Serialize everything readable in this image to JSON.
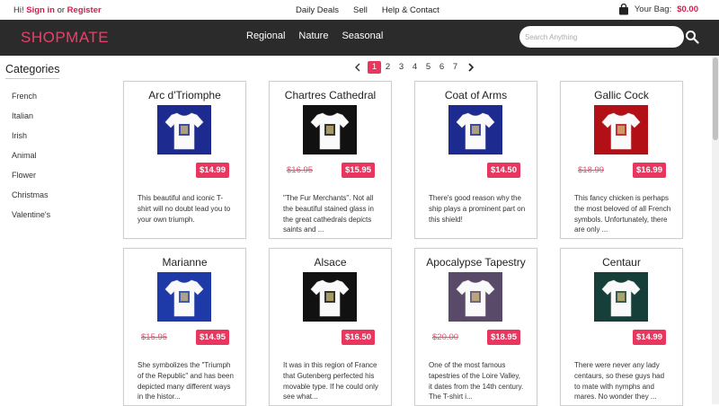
{
  "topbar": {
    "greet": "Hi!",
    "sign_in": "Sign in",
    "or": "or",
    "register": "Register",
    "links": [
      "Daily Deals",
      "Sell",
      "Help & Contact"
    ],
    "bag_label": "Your Bag:",
    "bag_amount": "$0.00"
  },
  "nav": {
    "logo": "SHOPMATE",
    "menu": [
      "Regional",
      "Nature",
      "Seasonal"
    ],
    "search_placeholder": "Search Anything"
  },
  "categories": {
    "title": "Categories",
    "items": [
      "French",
      "Italian",
      "Irish",
      "Animal",
      "Flower",
      "Christmas",
      "Valentine's"
    ]
  },
  "pagination": {
    "pages": [
      "1",
      "2",
      "3",
      "4",
      "5",
      "6",
      "7"
    ],
    "active": "1"
  },
  "products": [
    {
      "name": "Arc d'Triomphe",
      "old_price": "",
      "price": "$14.99",
      "color": "#1d2a8f",
      "desc": "This beautiful and iconic T-shirt will no doubt lead you to your own triumph."
    },
    {
      "name": "Chartres Cathedral",
      "old_price": "$16.95",
      "price": "$15.95",
      "color": "#111111",
      "desc": "\"The Fur Merchants\". Not all the beautiful stained glass in the great cathedrals depicts saints and ..."
    },
    {
      "name": "Coat of Arms",
      "old_price": "",
      "price": "$14.50",
      "color": "#1d2a8f",
      "desc": "There's good reason why the ship plays a prominent part on this shield!"
    },
    {
      "name": "Gallic Cock",
      "old_price": "$18.99",
      "price": "$16.99",
      "color": "#b30f16",
      "desc": "This fancy chicken is perhaps the most beloved of all French symbols. Unfortunately, there are only ..."
    },
    {
      "name": "Marianne",
      "old_price": "$15.95",
      "price": "$14.95",
      "color": "#1d3aa8",
      "desc": "She symbolizes the \"Triumph of the Republic\" and has been depicted many different ways in the histor..."
    },
    {
      "name": "Alsace",
      "old_price": "",
      "price": "$16.50",
      "color": "#111111",
      "desc": "It was in this region of France that Gutenberg perfected his movable type. If he could only see what..."
    },
    {
      "name": "Apocalypse Tapestry",
      "old_price": "$20.00",
      "price": "$18.95",
      "color": "#5a4a6a",
      "desc": "One of the most famous tapestries of the Loire Valley, it dates from the 14th century. The T-shirt i..."
    },
    {
      "name": "Centaur",
      "old_price": "",
      "price": "$14.99",
      "color": "#173f3a",
      "desc": "There were never any lady centaurs, so these guys had to mate with nymphs and mares. No wonder they ..."
    }
  ]
}
